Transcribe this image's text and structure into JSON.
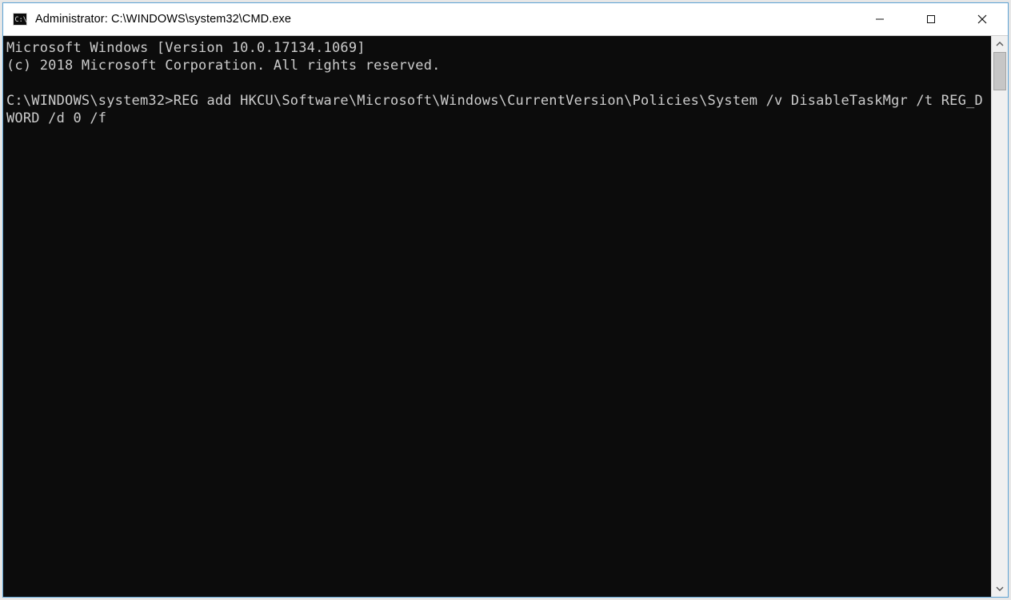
{
  "window": {
    "title": "Administrator: C:\\WINDOWS\\system32\\CMD.exe"
  },
  "console": {
    "banner_line1": "Microsoft Windows [Version 10.0.17134.1069]",
    "banner_line2": "(c) 2018 Microsoft Corporation. All rights reserved.",
    "prompt": "C:\\WINDOWS\\system32>",
    "command": "REG add HKCU\\Software\\Microsoft\\Windows\\CurrentVersion\\Policies\\System /v DisableTaskMgr /t REG_DWORD /d 0 /f"
  }
}
